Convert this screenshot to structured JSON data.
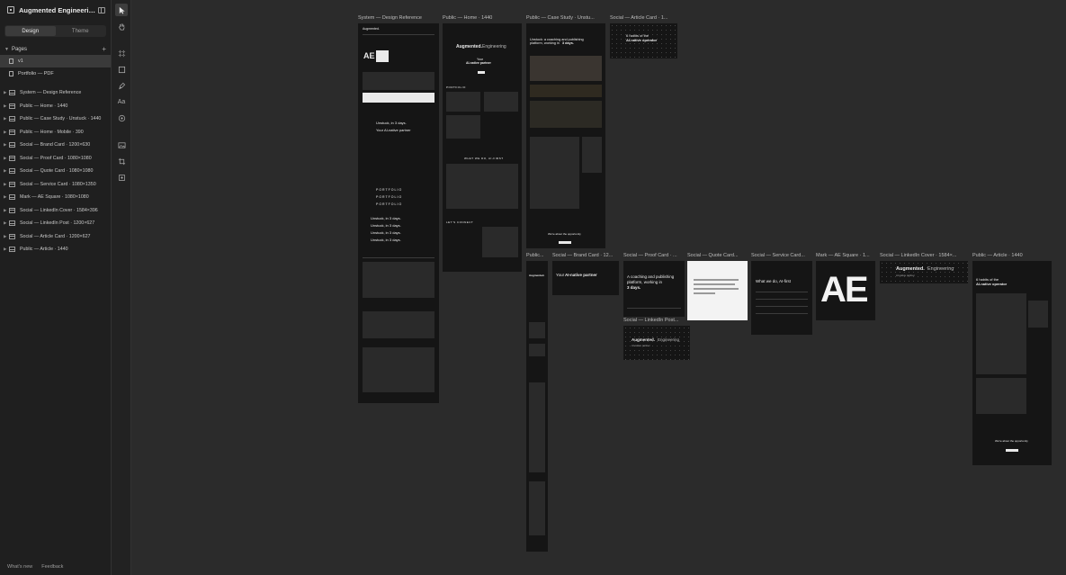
{
  "app": {
    "file_title": "Augmented Engineerin...",
    "tabs": {
      "design": "Design",
      "theme": "Theme"
    },
    "pages_label": "Pages",
    "pages": [
      "v1",
      "Portfolio — PDF"
    ],
    "active_page": 0,
    "layers": [
      "System — Design Reference",
      "Public — Home · 1440",
      "Public — Case Study · Unstuck · 1440",
      "Public — Home · Mobile · 390",
      "Social — Brand Card · 1200×630",
      "Social — Proof Card · 1080×1080",
      "Social — Quote Card · 1080×1080",
      "Social — Service Card · 1080×1350",
      "Mark — AE Square · 1080×1080",
      "Social — LinkedIn Cover · 1584×396",
      "Social — LinkedIn Post · 1200×627",
      "Social — Article Card · 1200×627",
      "Public — Article · 1440"
    ],
    "footer": {
      "whats_new": "What's new",
      "feedback": "Feedback"
    }
  },
  "tools": [
    "cursor-icon",
    "hand-icon",
    "frame-icon",
    "rectangle-icon",
    "pen-icon",
    "text-icon",
    "component-icon",
    "image-icon",
    "crop-icon",
    "plugin-icon"
  ],
  "canvas": {
    "frame_labels": {
      "system": "System — Design Reference",
      "home": "Public — Home · 1440",
      "case": "Public — Case Study · Unstu...",
      "article_card": "Social — Article Card · 1...",
      "mobile": "Public...",
      "brand": "Social — Brand Card · 12...",
      "proof": "Social — Proof Card · ...",
      "quote": "Social — Quote Card...",
      "service": "Social — Service Card...",
      "mark": "Mark — AE Square · 1...",
      "linkedin_cover": "Social — LinkedIn Cover · 1584×...",
      "article": "Public — Article · 1440",
      "linkedin_post": "Social — LinkedIn Post..."
    },
    "previews": {
      "brand_name_bold": "Augmented.",
      "brand_name_rest": "Engineering",
      "your": "Your",
      "ai_partner": "AI-native partner",
      "case_head_1": "Unstuck: a coaching and publishing",
      "case_head_2": "platform, working in",
      "case_head_3": "3 days.",
      "article_card_1": "6 habits of the",
      "article_card_2": "AI-native operator",
      "portfolio": "PORTFOLIO",
      "what_we_do": "WHAT WE DO, AI-FIRST",
      "lets_connect": "LET'S CONNECT",
      "unstuck_3_days": "Unstuck, in 3 days.",
      "your_ai_partner": "Your AI-native partner",
      "what_we_do_short": "What we do, AI-first",
      "proof_1": "A coaching and publishing",
      "proof_2": "platform, working in",
      "proof_3": "3 days.",
      "ae": "AE",
      "opportunity": "We're about the opportunity"
    }
  }
}
